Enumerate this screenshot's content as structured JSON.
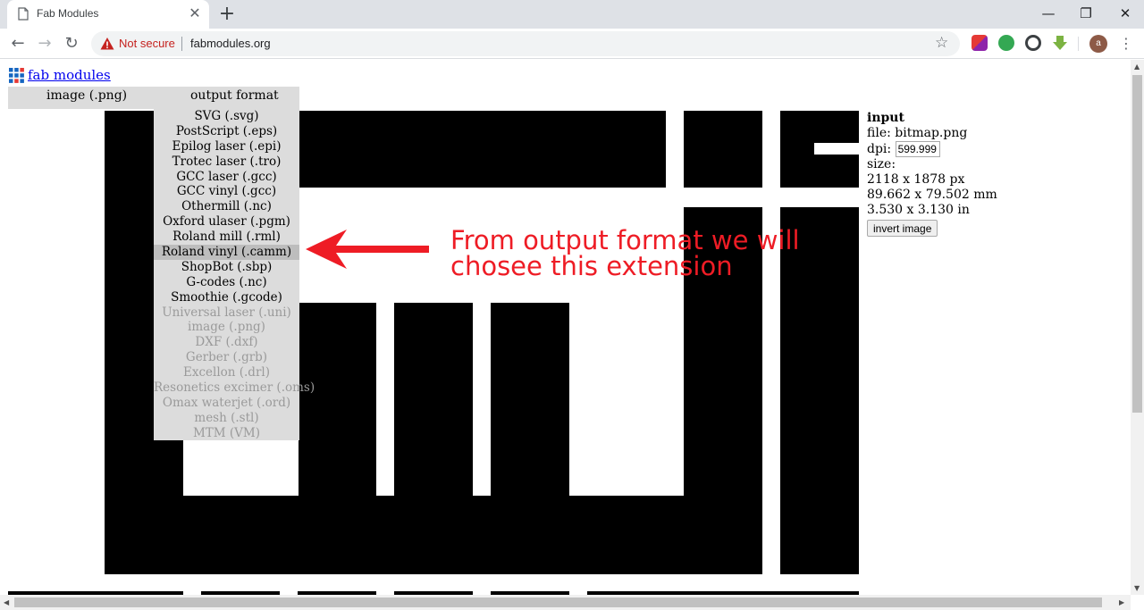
{
  "browser": {
    "tab_title": "Fab Modules",
    "tab_close": "✕",
    "new_tab": "+",
    "window_minimize": "—",
    "window_restore": "❐",
    "window_close": "✕",
    "nav_back": "←",
    "nav_forward": "→",
    "nav_reload": "↻",
    "security_label": "Not secure",
    "url": "fabmodules.org",
    "bookmark_icon": "☆",
    "profile_initial": "a",
    "menu": "⋮"
  },
  "page": {
    "logo_link": "fab modules",
    "menu": {
      "input_label": "image (.png)",
      "output_label": "output format"
    },
    "output_formats": [
      {
        "label": "SVG (.svg)",
        "enabled": true
      },
      {
        "label": "PostScript (.eps)",
        "enabled": true
      },
      {
        "label": "Epilog laser (.epi)",
        "enabled": true
      },
      {
        "label": "Trotec laser (.tro)",
        "enabled": true
      },
      {
        "label": "GCC laser (.gcc)",
        "enabled": true
      },
      {
        "label": "GCC vinyl (.gcc)",
        "enabled": true
      },
      {
        "label": "Othermill (.nc)",
        "enabled": true
      },
      {
        "label": "Oxford ulaser (.pgm)",
        "enabled": true
      },
      {
        "label": "Roland mill (.rml)",
        "enabled": true
      },
      {
        "label": "Roland vinyl (.camm)",
        "enabled": true,
        "selected": true
      },
      {
        "label": "ShopBot (.sbp)",
        "enabled": true
      },
      {
        "label": "G-codes (.nc)",
        "enabled": true
      },
      {
        "label": "Smoothie (.gcode)",
        "enabled": true
      },
      {
        "label": "Universal laser (.uni)",
        "enabled": false
      },
      {
        "label": "image (.png)",
        "enabled": false
      },
      {
        "label": "DXF (.dxf)",
        "enabled": false
      },
      {
        "label": "Gerber (.grb)",
        "enabled": false
      },
      {
        "label": "Excellon (.drl)",
        "enabled": false
      },
      {
        "label": "Resonetics excimer (.oms)",
        "enabled": false
      },
      {
        "label": "Omax waterjet (.ord)",
        "enabled": false
      },
      {
        "label": "mesh (.stl)",
        "enabled": false
      },
      {
        "label": "MTM (VM)",
        "enabled": false
      }
    ],
    "annotation": {
      "line1": "From output format we will",
      "line2": "chosee this extension",
      "color": "#ee1c25"
    },
    "input_panel": {
      "heading": "input",
      "file_label": "file: bitmap.png",
      "dpi_label": "dpi:",
      "dpi_value": "599.999",
      "size_label": "size:",
      "size_px": "2118 x 1878 px",
      "size_mm": "89.662 x 79.502 mm",
      "size_in": "3.530 x 3.130 in",
      "invert_button": "invert image"
    }
  }
}
